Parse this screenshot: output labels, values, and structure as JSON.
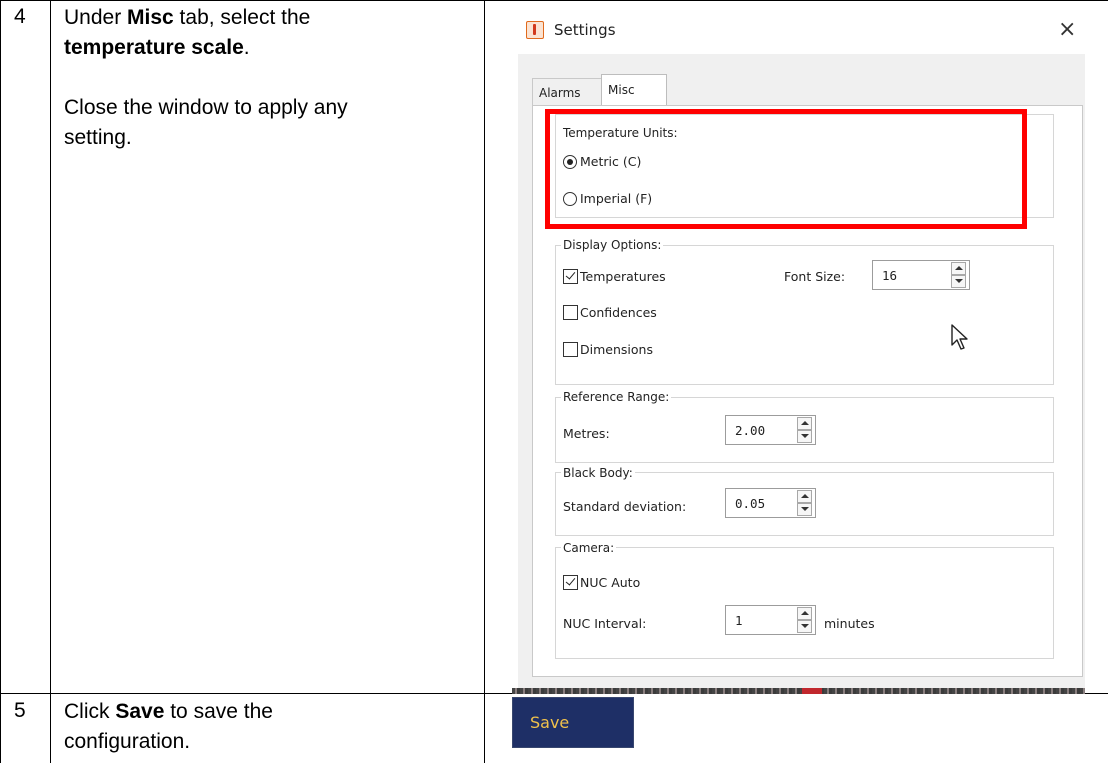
{
  "steps": [
    {
      "number": "4",
      "line1_pre": "Under ",
      "line1_bold": "Misc",
      "line1_post": " tab, select the",
      "line2_bold": "temperature scale",
      "line2_post": ".",
      "para2_line1": "Close the window to apply any",
      "para2_line2": "setting."
    },
    {
      "number": "5",
      "line1_pre": "Click ",
      "line1_bold": "Save",
      "line1_post": " to save the",
      "line2": "configuration."
    }
  ],
  "dialog": {
    "title": "Settings",
    "close_glyph": "×",
    "tabs": [
      "Alarms",
      "Misc"
    ],
    "active_tab": "Misc",
    "temperature_units": {
      "title": "Temperature Units:",
      "options": [
        "Metric (C)",
        "Imperial (F)"
      ],
      "selected": "Metric (C)"
    },
    "display_options": {
      "title": "Display Options:",
      "temperatures": {
        "label": "Temperatures",
        "checked": true
      },
      "confidences": {
        "label": "Confidences",
        "checked": false
      },
      "dimensions": {
        "label": "Dimensions",
        "checked": false
      },
      "font_size_label": "Font Size:",
      "font_size_value": "16"
    },
    "reference_range": {
      "title": "Reference Range:",
      "metres_label": "Metres:",
      "metres_value": "2.00"
    },
    "black_body": {
      "title": "Black Body:",
      "std_label": "Standard deviation:",
      "std_value": "0.05"
    },
    "camera": {
      "title": "Camera:",
      "nuc_auto": {
        "label": "NUC Auto",
        "checked": true
      },
      "nuc_interval_label": "NUC Interval:",
      "nuc_interval_value": "1",
      "nuc_interval_unit": "minutes"
    }
  },
  "save_button": "Save",
  "colors": {
    "highlight": "#ff0000",
    "save_bg": "#1e2f66",
    "save_text": "#f0c14b"
  }
}
